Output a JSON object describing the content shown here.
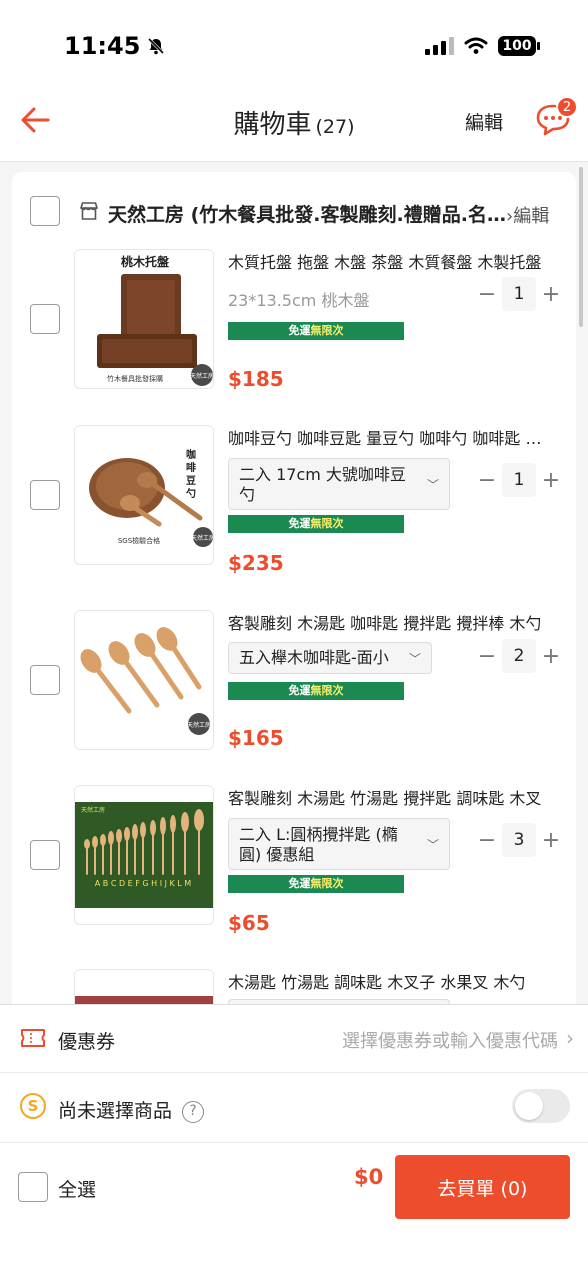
{
  "status_bar": {
    "time": "11:45",
    "battery": "100"
  },
  "header": {
    "title": "購物車",
    "count": "(27)",
    "edit_label": "編輯",
    "chat_badge": "2"
  },
  "shop": {
    "name": "天然工房 (竹木餐具批發.客製雕刻.禮贈品.名片架.聯名)",
    "edit_label": "編輯"
  },
  "items": [
    {
      "name": "木質托盤 拖盤 木盤 茶盤 木質餐盤 木製托盤",
      "variation": "23*13.5cm 桃木盤",
      "badge_prefix": "免運",
      "badge_highlight": "無限次",
      "price": "$185",
      "qty": "1",
      "thumb_title": "桃木托盤",
      "thumb_caption": "竹木餐具批發採購",
      "thumb_seal": "天然工房"
    },
    {
      "name": "咖啡豆勺 咖啡豆匙 量豆勺 咖啡勺 咖啡匙 木勺",
      "variation": "二入 17cm 大號咖啡豆勺",
      "badge_prefix": "免運",
      "badge_highlight": "無限次",
      "price": "$235",
      "qty": "1",
      "thumb_title": "咖啡豆勺",
      "thumb_caption": "SGS檢驗合格",
      "thumb_seal": "天然工房"
    },
    {
      "name": "客製雕刻 木湯匙 咖啡匙 攪拌匙 攪拌棒 木勺",
      "variation": "五入櫸木咖啡匙-面小",
      "badge_prefix": "免運",
      "badge_highlight": "無限次",
      "price": "$165",
      "qty": "2",
      "thumb_seal": "天然工房"
    },
    {
      "name": "客製雕刻 木湯匙 竹湯匙 攪拌匙 調味匙 木叉",
      "variation": "二入 L:圓柄攪拌匙 (橢圓) 優惠組",
      "badge_prefix": "免運",
      "badge_highlight": "無限次",
      "price": "$65",
      "qty": "3",
      "thumb_title": "天然工房",
      "thumb_letters": "A B C D E F G H I J K L M"
    },
    {
      "name": "木湯匙 竹湯匙 調味匙 木叉子 水果叉 木勺"
    }
  ],
  "coupon": {
    "label": "優惠券",
    "hint": "選擇優惠券或輸入優惠代碼"
  },
  "coins": {
    "label": "尚未選擇商品",
    "icon_letter": "S",
    "help": "?"
  },
  "footer": {
    "select_all": "全選",
    "total": "$0",
    "checkout": "去買單 (0)"
  },
  "colors": {
    "accent": "#ee4d2d",
    "badge_green": "#1b8a52"
  }
}
